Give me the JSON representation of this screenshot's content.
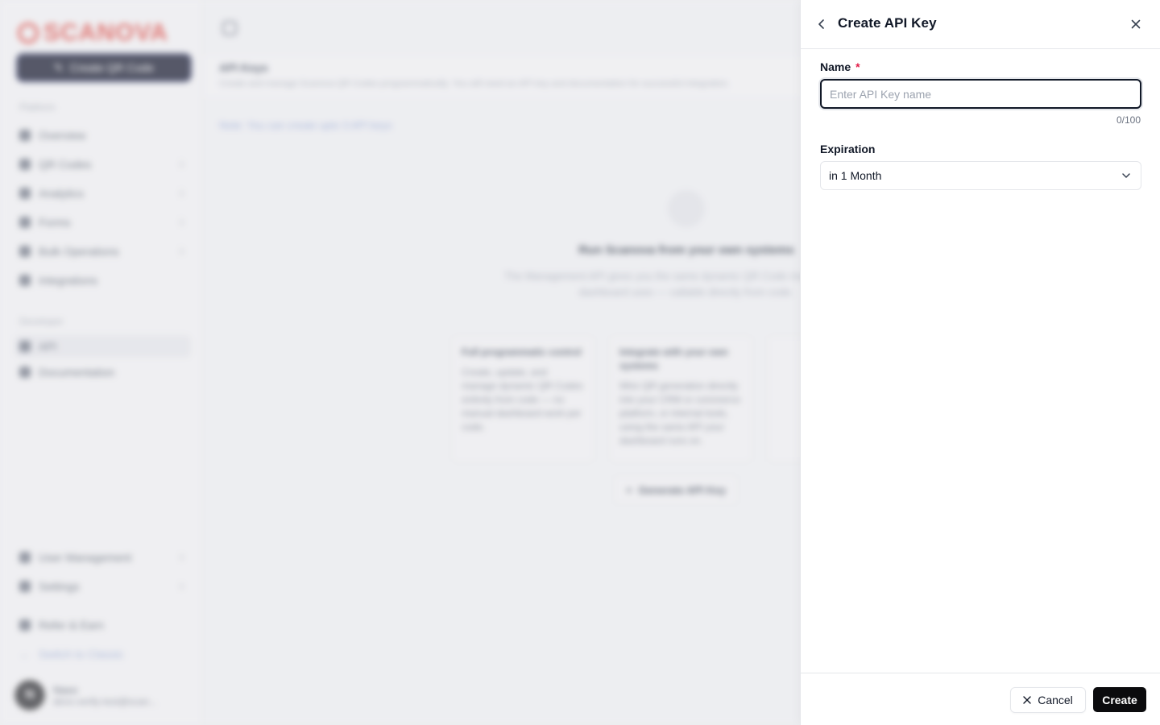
{
  "app": {
    "logo_text": "SCANOVA",
    "create_qr_label": "Create QR Code",
    "sidebar": {
      "platform_label": "Platform",
      "platform_items": [
        {
          "label": "Overview"
        },
        {
          "label": "QR Codes"
        },
        {
          "label": "Analytics"
        },
        {
          "label": "Forms"
        },
        {
          "label": "Bulk Operations"
        },
        {
          "label": "Integrations"
        }
      ],
      "developer_label": "Developer",
      "developer_items": [
        {
          "label": "API"
        },
        {
          "label": "Documentation"
        }
      ],
      "bottom_items": [
        {
          "label": "User Management"
        },
        {
          "label": "Settings"
        },
        {
          "label": "Refer & Earn"
        }
      ],
      "switch_classic": "Switch to Classic",
      "user": {
        "initial": "N",
        "name": "Naxo",
        "email": "devs-verify-test@scan..."
      }
    },
    "main": {
      "page_title": "API Keys",
      "page_subtitle": "Create and manage Scanova QR Codes programmatically. You will need an API key and documentation for successful integration.",
      "note": "Note: You can create upto 3 API keys",
      "empty_title": "Run Scanova from your own systems",
      "empty_desc": "The Management API gives you the same dynamic QR Code management the dashboard uses — callable directly from code.",
      "cards": [
        {
          "title": "Full programmatic control",
          "desc": "Create, update, and manage dynamic QR Codes entirely from code — no manual dashboard work per code."
        },
        {
          "title": "Integrate with your own systems",
          "desc": "Wire QR generation directly into your CRM or commerce platform, or internal tools, using the same API your dashboard runs on."
        },
        {
          "title": "",
          "desc": ""
        }
      ],
      "generate_button": "Generate API Key"
    }
  },
  "drawer": {
    "title": "Create API Key",
    "name_label": "Name",
    "required_mark": "*",
    "name_placeholder": "Enter API Key name",
    "name_value": "",
    "name_counter": "0/100",
    "expiration_label": "Expiration",
    "expiration_value": "in 1 Month",
    "cancel_label": "Cancel",
    "create_label": "Create"
  },
  "colors": {
    "brand": "#e0463e",
    "primary_button": "#0b0b0d",
    "required": "#e11d48"
  },
  "icons": {
    "back": "chevron-left-icon",
    "close": "close-icon",
    "select": "chevron-down-icon",
    "cancel": "x-icon"
  }
}
